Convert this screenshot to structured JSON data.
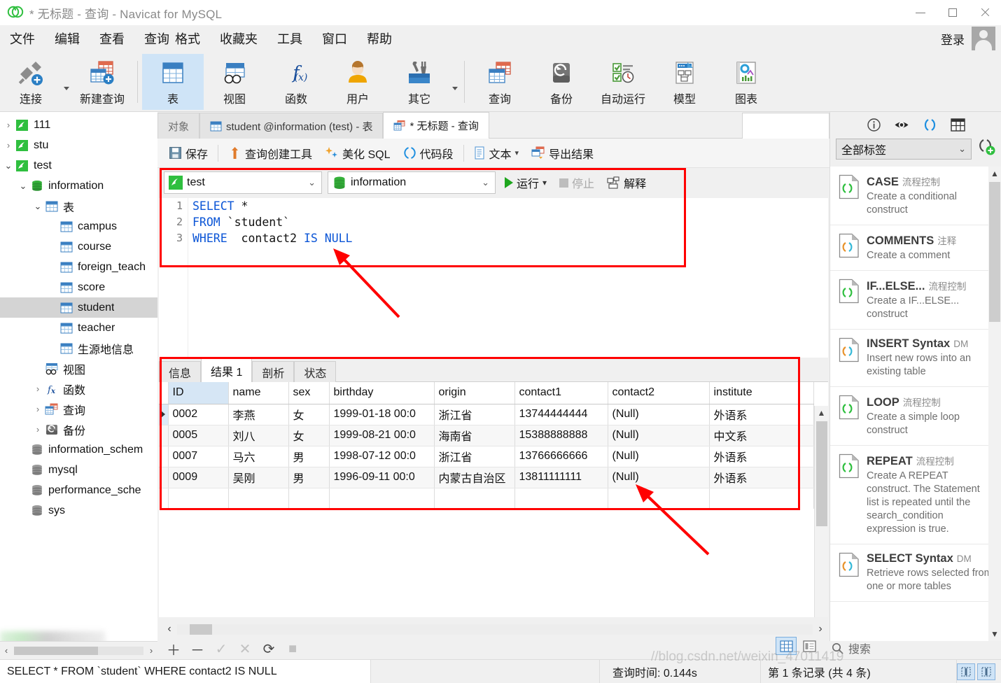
{
  "window": {
    "title": "* 无标题 - 查询 - Navicat for MySQL",
    "minimize": "—",
    "maximize": "□",
    "close": "✕"
  },
  "menubar": {
    "items": [
      "文件",
      "编辑",
      "查看",
      "查询",
      "格式",
      "收藏夹",
      "工具",
      "窗口",
      "帮助"
    ],
    "login_label": "登录"
  },
  "ribbon": {
    "groups": [
      {
        "buttons": [
          {
            "label": "连接",
            "icon": "connect-icon",
            "caret": true
          },
          {
            "label": "新建查询",
            "icon": "new-query-icon",
            "caret": false
          }
        ]
      },
      {
        "buttons": [
          {
            "label": "表",
            "icon": "table-icon",
            "active": true,
            "caret": false
          },
          {
            "label": "视图",
            "icon": "view-icon",
            "caret": false
          },
          {
            "label": "函数",
            "icon": "function-icon",
            "caret": false
          },
          {
            "label": "用户",
            "icon": "user-icon",
            "caret": false
          },
          {
            "label": "其它",
            "icon": "other-icon",
            "caret": true
          }
        ]
      },
      {
        "buttons": [
          {
            "label": "查询",
            "icon": "query-icon",
            "caret": false
          },
          {
            "label": "备份",
            "icon": "backup-icon",
            "caret": false
          },
          {
            "label": "自动运行",
            "icon": "automation-icon",
            "caret": false
          },
          {
            "label": "模型",
            "icon": "model-icon",
            "caret": false
          },
          {
            "label": "图表",
            "icon": "chart-icon",
            "caret": false
          }
        ]
      }
    ]
  },
  "sidebar": {
    "tree": [
      {
        "label": "111",
        "icon": "connection-icon",
        "indent": 0,
        "arrow": "collapsed"
      },
      {
        "label": "stu",
        "icon": "connection-icon",
        "indent": 0,
        "arrow": "collapsed"
      },
      {
        "label": "test",
        "icon": "connection-icon",
        "indent": 0,
        "arrow": "expanded"
      },
      {
        "label": "information",
        "icon": "database-icon",
        "indent": 1,
        "arrow": "expanded"
      },
      {
        "label": "表",
        "icon": "tables-folder-icon",
        "indent": 2,
        "arrow": "expanded"
      },
      {
        "label": "campus",
        "icon": "table-item-icon",
        "indent": 3,
        "arrow": "none"
      },
      {
        "label": "course",
        "icon": "table-item-icon",
        "indent": 3,
        "arrow": "none"
      },
      {
        "label": "foreign_teach",
        "icon": "table-item-icon",
        "indent": 3,
        "arrow": "none"
      },
      {
        "label": "score",
        "icon": "table-item-icon",
        "indent": 3,
        "arrow": "none"
      },
      {
        "label": "student",
        "icon": "table-item-icon",
        "indent": 3,
        "arrow": "none",
        "selected": true
      },
      {
        "label": "teacher",
        "icon": "table-item-icon",
        "indent": 3,
        "arrow": "none"
      },
      {
        "label": "生源地信息",
        "icon": "table-item-icon",
        "indent": 3,
        "arrow": "none"
      },
      {
        "label": "视图",
        "icon": "views-folder-icon",
        "indent": 2,
        "arrow": "none"
      },
      {
        "label": "函数",
        "icon": "functions-folder-icon",
        "indent": 2,
        "arrow": "collapsed"
      },
      {
        "label": "查询",
        "icon": "queries-folder-icon",
        "indent": 2,
        "arrow": "collapsed"
      },
      {
        "label": "备份",
        "icon": "backups-folder-icon",
        "indent": 2,
        "arrow": "collapsed"
      },
      {
        "label": "information_schem",
        "icon": "database-grey-icon",
        "indent": 1,
        "arrow": "none"
      },
      {
        "label": "mysql",
        "icon": "database-grey-icon",
        "indent": 1,
        "arrow": "none"
      },
      {
        "label": "performance_sche",
        "icon": "database-grey-icon",
        "indent": 1,
        "arrow": "none"
      },
      {
        "label": "sys",
        "icon": "database-grey-icon",
        "indent": 1,
        "arrow": "none"
      }
    ]
  },
  "main_tabs": [
    {
      "label": "对象",
      "icon": "none",
      "active": false
    },
    {
      "label": "student @information (test) - 表",
      "icon": "table-item-icon",
      "active": false
    },
    {
      "label": "* 无标题 - 查询",
      "icon": "query-icon",
      "active": true
    }
  ],
  "query_toolbar": [
    {
      "label": "保存",
      "icon": "save-icon"
    },
    {
      "label": "查询创建工具",
      "icon": "query-builder-icon"
    },
    {
      "label": "美化 SQL",
      "icon": "beautify-sql-icon"
    },
    {
      "label": "代码段",
      "icon": "code-snippet-icon"
    },
    {
      "label": "文本",
      "icon": "text-icon",
      "caret": true
    },
    {
      "label": "导出结果",
      "icon": "export-result-icon"
    }
  ],
  "conn_row": {
    "connection": "test",
    "database": "information",
    "run_label": "运行",
    "stop_label": "停止",
    "explain_label": "解释"
  },
  "editor": {
    "lines": [
      {
        "no": "1",
        "tokens": [
          {
            "t": "SELECT",
            "k": true
          },
          {
            "t": " *",
            "k": false
          }
        ]
      },
      {
        "no": "2",
        "tokens": [
          {
            "t": "FROM",
            "k": true
          },
          {
            "t": " `student`",
            "k": false
          }
        ]
      },
      {
        "no": "3",
        "tokens": [
          {
            "t": "WHERE",
            "k": true
          },
          {
            "t": "  contact2 ",
            "k": false
          },
          {
            "t": "IS NULL",
            "k": true
          }
        ]
      }
    ]
  },
  "result": {
    "tabs": [
      "信息",
      "结果 1",
      "剖析",
      "状态"
    ],
    "active_tab": "结果 1",
    "columns": [
      "ID",
      "name",
      "sex",
      "birthday",
      "origin",
      "contact1",
      "contact2",
      "institute"
    ],
    "rows": [
      [
        "0002",
        "李燕",
        "女",
        "1999-01-18 00:0",
        "浙江省",
        "13744444444",
        "(Null)",
        "外语系"
      ],
      [
        "0005",
        "刘八",
        "女",
        "1999-08-21 00:0",
        "海南省",
        "15388888888",
        "(Null)",
        "中文系"
      ],
      [
        "0007",
        "马六",
        "男",
        "1998-07-12 00:0",
        "浙江省",
        "13766666666",
        "(Null)",
        "外语系"
      ],
      [
        "0009",
        "吴刚",
        "男",
        "1996-09-11 00:0",
        "内蒙古自治区",
        "13811111111",
        "(Null)",
        "外语系"
      ]
    ],
    "null_text": "(Null)"
  },
  "grid_edit_bar": {
    "add": "＋",
    "remove": "－",
    "confirm": "✓",
    "cancel": "✕",
    "refresh": "⟳",
    "stop": "■"
  },
  "search": {
    "placeholder": "搜索",
    "icon": "search-icon"
  },
  "right_panel": {
    "top_icons": [
      "info-icon",
      "eye-icon",
      "code-snippet-icon",
      "grid-icon"
    ],
    "filter_value": "全部标签",
    "add_icon": "add-snippet-icon",
    "snippets": [
      {
        "title": "CASE",
        "tag": "流程控制",
        "desc": "Create a conditional construct",
        "icon": "snippet-green-icon"
      },
      {
        "title": "COMMENTS",
        "tag": "注释",
        "desc": "Create a comment",
        "icon": "snippet-color-icon"
      },
      {
        "title": "IF...ELSE...",
        "tag": "流程控制",
        "desc": "Create a IF...ELSE... construct",
        "icon": "snippet-green-icon"
      },
      {
        "title": "INSERT Syntax",
        "tag": "DM",
        "desc": "Insert new rows into an existing table",
        "icon": "snippet-color-icon"
      },
      {
        "title": "LOOP",
        "tag": "流程控制",
        "desc": "Create a simple loop construct",
        "icon": "snippet-green-icon"
      },
      {
        "title": "REPEAT",
        "tag": "流程控制",
        "desc": "Create A REPEAT construct. The Statement list is repeated until the search_condition expression is true.",
        "icon": "snippet-green-icon"
      },
      {
        "title": "SELECT Syntax",
        "tag": "DM",
        "desc": "Retrieve rows selected from one or more tables",
        "icon": "snippet-color-icon"
      }
    ]
  },
  "statusbar": {
    "sql": "SELECT * FROM `student` WHERE  contact2 IS NULL",
    "query_time": "查询时间: 0.144s",
    "record_info": "第 1 条记录 (共 4 条)"
  },
  "watermark": "//blog.csdn.net/weixin_47011419",
  "colors": {
    "annotation_red": "#ff0000",
    "keyword_blue": "#0b55d6",
    "accent_blue": "#3a7fc1",
    "selection_gray": "#d4d4d4",
    "green_conn": "#2fbf3f"
  }
}
